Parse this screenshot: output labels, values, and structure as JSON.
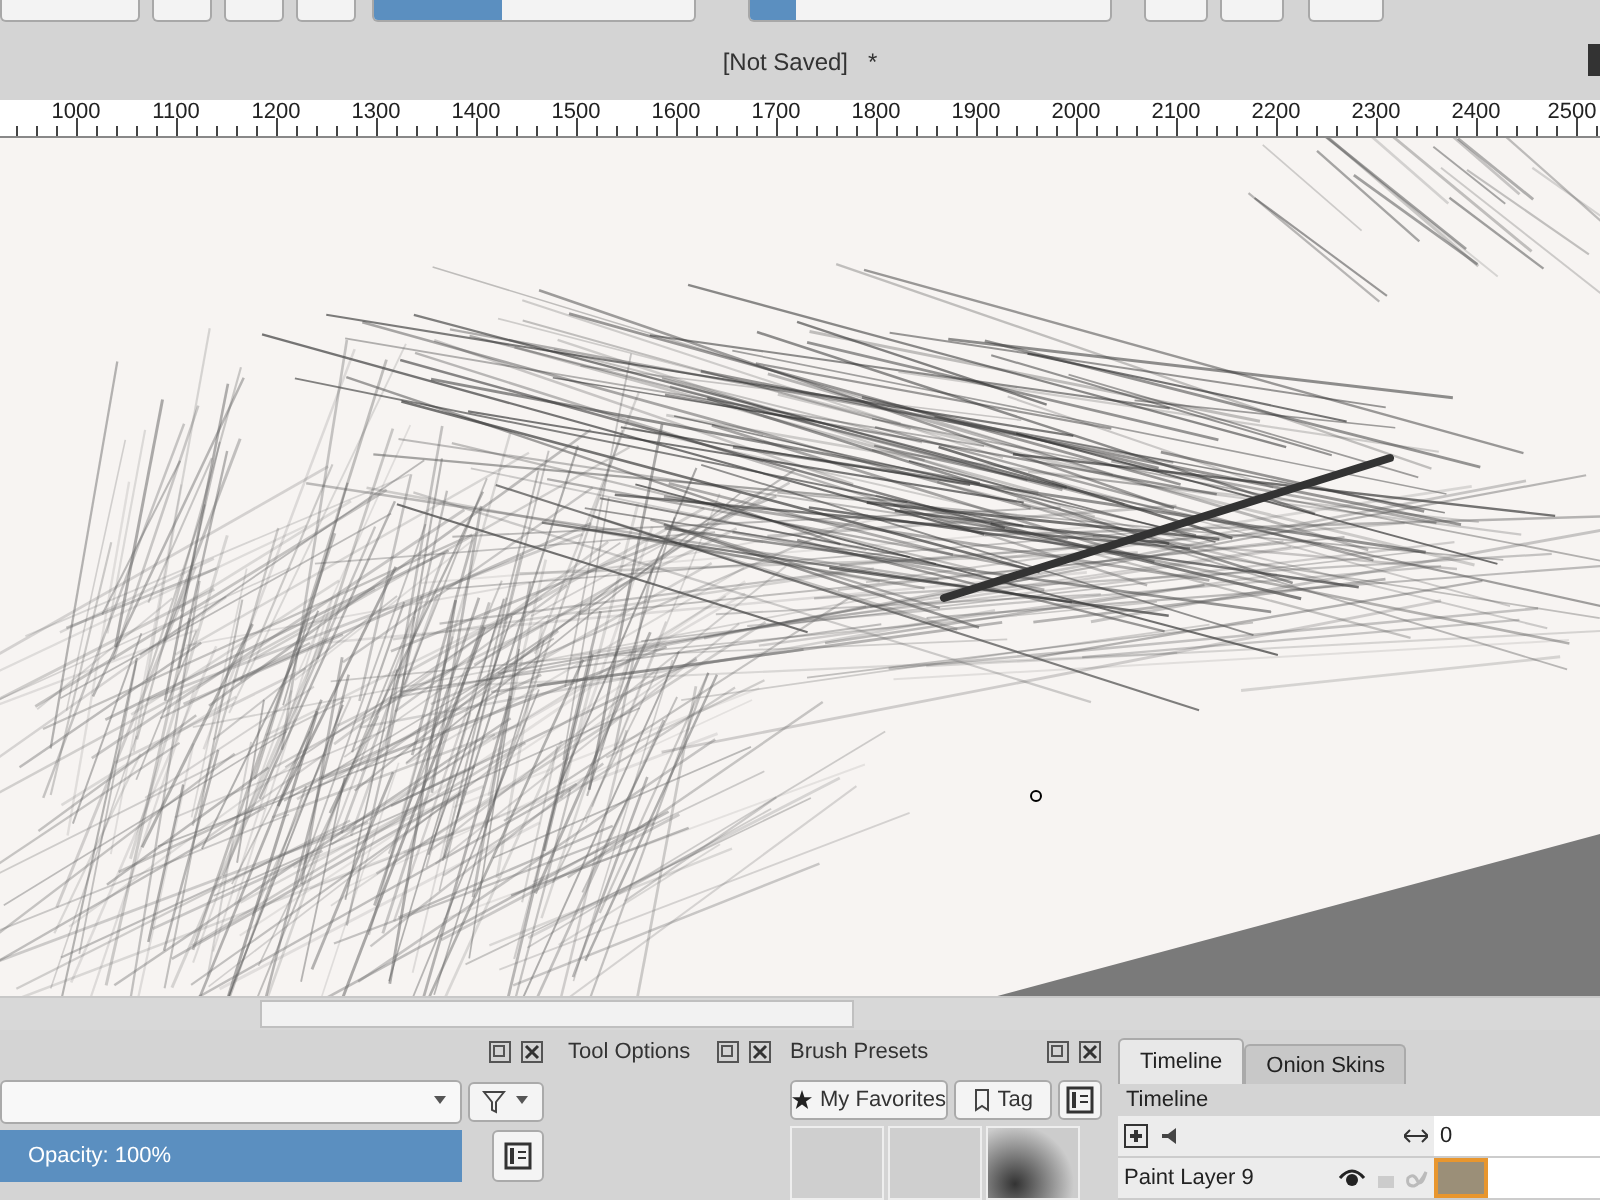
{
  "toolbar": {
    "size_slider": {
      "level": 0.4
    },
    "opacity_slider": {
      "level": 0.13
    }
  },
  "document": {
    "title": "[Not Saved]",
    "modified": "*"
  },
  "ruler": {
    "labels": [
      "1000",
      "1100",
      "1200",
      "1300",
      "1400",
      "1500",
      "1600",
      "1700",
      "1800",
      "1900",
      "2000",
      "2100",
      "2200",
      "2300",
      "2400",
      "2500"
    ]
  },
  "layers_docker": {
    "opacity_slider": {
      "label": "Opacity:  100%",
      "level": 1
    }
  },
  "tool_options": {
    "title": "Tool Options"
  },
  "brush_presets": {
    "title": "Brush Presets",
    "favorites": "My Favorites",
    "tag": "Tag"
  },
  "timeline": {
    "tabs": [
      {
        "label": "Timeline",
        "selected": true
      },
      {
        "label": "Onion Skins",
        "selected": false
      }
    ],
    "title": "Timeline",
    "frame": "0",
    "layers": [
      {
        "name": "Paint Layer 9",
        "visible": true
      }
    ]
  }
}
